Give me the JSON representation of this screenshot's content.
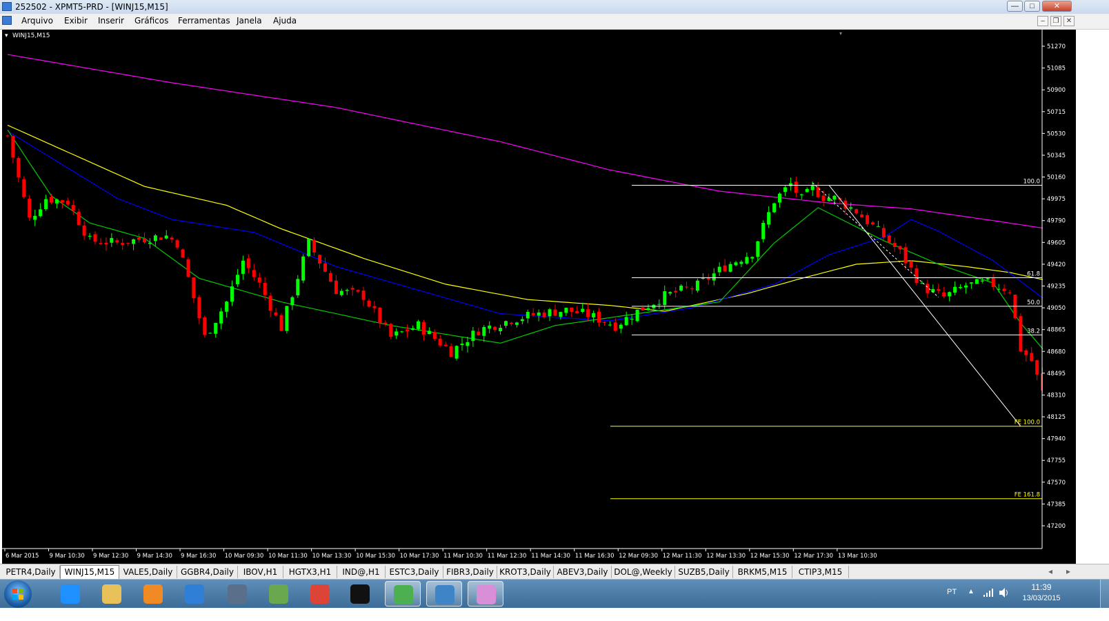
{
  "window": {
    "title": "252502 - XPMT5-PRD - [WINJ15,M15]",
    "minimize_glyph": "—",
    "maximize_glyph": "□",
    "close_glyph": "✕"
  },
  "menu": {
    "items": [
      "Arquivo",
      "Exibir",
      "Inserir",
      "Gráficos",
      "Ferramentas",
      "Janela",
      "Ajuda"
    ],
    "mdi_buttons": [
      "–",
      "❐",
      "✕"
    ]
  },
  "chart_data": {
    "type": "candlestick",
    "symbol_label": "WINJ15,M15",
    "y_ticks": [
      51270,
      51085,
      50900,
      50715,
      50530,
      50345,
      50160,
      49975,
      49790,
      49605,
      49420,
      49235,
      49050,
      48865,
      48680,
      48495,
      48310,
      48125,
      47940,
      47755,
      47570,
      47385,
      47200
    ],
    "ylim": [
      47000,
      51340
    ],
    "x_ticks": [
      "6 Mar 2015",
      "9 Mar 10:30",
      "9 Mar 12:30",
      "9 Mar 14:30",
      "9 Mar 16:30",
      "10 Mar 09:30",
      "10 Mar 11:30",
      "10 Mar 13:30",
      "10 Mar 15:30",
      "10 Mar 17:30",
      "11 Mar 10:30",
      "11 Mar 12:30",
      "11 Mar 14:30",
      "11 Mar 16:30",
      "12 Mar 09:30",
      "12 Mar 11:30",
      "12 Mar 13:30",
      "12 Mar 15:30",
      "12 Mar 17:30",
      "13 Mar 10:30"
    ],
    "x_tick_step": 8,
    "close_anchors": [
      [
        0,
        50510
      ],
      [
        2,
        50150
      ],
      [
        4,
        49800
      ],
      [
        7,
        49980
      ],
      [
        11,
        49950
      ],
      [
        15,
        49620
      ],
      [
        20,
        49600
      ],
      [
        25,
        49640
      ],
      [
        29,
        49660
      ],
      [
        31,
        49600
      ],
      [
        33,
        49300
      ],
      [
        36,
        48800
      ],
      [
        40,
        49100
      ],
      [
        43,
        49450
      ],
      [
        46,
        49250
      ],
      [
        50,
        48880
      ],
      [
        55,
        49600
      ],
      [
        60,
        49200
      ],
      [
        65,
        49150
      ],
      [
        70,
        48800
      ],
      [
        75,
        48900
      ],
      [
        81,
        48680
      ],
      [
        86,
        48860
      ],
      [
        92,
        48950
      ],
      [
        97,
        49000
      ],
      [
        102,
        49030
      ],
      [
        106,
        48990
      ],
      [
        111,
        48900
      ],
      [
        115,
        49020
      ],
      [
        120,
        49150
      ],
      [
        126,
        49240
      ],
      [
        131,
        49400
      ],
      [
        136,
        49520
      ],
      [
        140,
        49960
      ],
      [
        143,
        50100
      ],
      [
        145,
        49970
      ],
      [
        147,
        50060
      ],
      [
        149,
        49990
      ],
      [
        151,
        49980
      ],
      [
        155,
        49870
      ],
      [
        159,
        49700
      ],
      [
        163,
        49520
      ],
      [
        167,
        49230
      ],
      [
        171,
        49140
      ],
      [
        175,
        49240
      ],
      [
        179,
        49260
      ],
      [
        183,
        49200
      ],
      [
        185,
        48700
      ],
      [
        187,
        48600
      ],
      [
        189,
        48330
      ],
      [
        191,
        48470
      ],
      [
        193,
        48520
      ],
      [
        195,
        48560
      ],
      [
        197,
        48600
      ],
      [
        199,
        48680
      ]
    ],
    "series": [
      {
        "name": "",
        "color": "#ff00ff",
        "points": [
          [
            0,
            51200
          ],
          [
            30,
            50960
          ],
          [
            60,
            50750
          ],
          [
            90,
            50460
          ],
          [
            110,
            50220
          ],
          [
            130,
            50040
          ],
          [
            150,
            49940
          ],
          [
            165,
            49890
          ],
          [
            180,
            49790
          ],
          [
            190,
            49720
          ],
          [
            199,
            49660
          ]
        ]
      },
      {
        "name": "",
        "color": "#ffff00",
        "points": [
          [
            0,
            50600
          ],
          [
            25,
            50080
          ],
          [
            40,
            49920
          ],
          [
            50,
            49720
          ],
          [
            65,
            49470
          ],
          [
            80,
            49250
          ],
          [
            95,
            49120
          ],
          [
            110,
            49070
          ],
          [
            120,
            49020
          ],
          [
            135,
            49170
          ],
          [
            145,
            49300
          ],
          [
            155,
            49420
          ],
          [
            165,
            49450
          ],
          [
            175,
            49400
          ],
          [
            183,
            49350
          ],
          [
            190,
            49280
          ],
          [
            199,
            49090
          ]
        ]
      },
      {
        "name": "",
        "color": "#0000ff",
        "points": [
          [
            0,
            50550
          ],
          [
            20,
            49980
          ],
          [
            30,
            49800
          ],
          [
            45,
            49690
          ],
          [
            60,
            49400
          ],
          [
            75,
            49200
          ],
          [
            90,
            49000
          ],
          [
            110,
            48940
          ],
          [
            125,
            49050
          ],
          [
            140,
            49250
          ],
          [
            150,
            49500
          ],
          [
            160,
            49650
          ],
          [
            165,
            49800
          ],
          [
            170,
            49700
          ],
          [
            180,
            49450
          ],
          [
            190,
            49100
          ],
          [
            199,
            48880
          ]
        ]
      },
      {
        "name": "",
        "color": "#00cc00",
        "points": [
          [
            0,
            50560
          ],
          [
            8,
            50000
          ],
          [
            15,
            49770
          ],
          [
            25,
            49640
          ],
          [
            35,
            49300
          ],
          [
            50,
            49100
          ],
          [
            70,
            48900
          ],
          [
            90,
            48750
          ],
          [
            100,
            48900
          ],
          [
            115,
            49000
          ],
          [
            130,
            49100
          ],
          [
            140,
            49600
          ],
          [
            148,
            49900
          ],
          [
            160,
            49620
          ],
          [
            170,
            49420
          ],
          [
            180,
            49260
          ],
          [
            185,
            48920
          ],
          [
            190,
            48650
          ],
          [
            195,
            48560
          ],
          [
            199,
            48620
          ]
        ]
      }
    ],
    "fibonacci_retracement": {
      "levels": [
        {
          "label": "100.0",
          "price": 50090
        },
        {
          "label": "61.8",
          "price": 49305
        },
        {
          "label": "50.0",
          "price": 49063
        },
        {
          "label": "38.2",
          "price": 48820
        }
      ]
    },
    "fibonacci_expansion": {
      "levels": [
        {
          "label": "FE 100.0",
          "price": 48045
        },
        {
          "label": "FE 161.8",
          "price": 47430
        }
      ],
      "color": "#ffff00"
    },
    "trend_lines": [
      {
        "from": [
          150,
          50090
        ],
        "to": [
          185,
          48045
        ],
        "color": "#ffffff",
        "dash": false
      },
      {
        "from": [
          147,
          50110
        ],
        "to": [
          170,
          49140
        ],
        "color": "#ffffff",
        "dash": true
      }
    ],
    "grid": false,
    "bull_color": "#00ff00",
    "bear_color": "#ff0000"
  },
  "symbol_tabs": [
    "PETR4,Daily",
    "WINJ15,M15",
    "VALE5,Daily",
    "GGBR4,Daily",
    "IBOV,H1",
    "HGTX3,H1",
    "IND@,H1",
    "ESTC3,Daily",
    "FIBR3,Daily",
    "KROT3,Daily",
    "ABEV3,Daily",
    "DOL@,Weekly",
    "SUZB5,Daily",
    "BRKM5,M15",
    "CTIP3,M15"
  ],
  "active_tab": "WINJ15,M15",
  "tab_scroll": {
    "left": "◂",
    "right": "▸"
  },
  "taskbar": {
    "apps": [
      {
        "name": "internet-explorer-icon",
        "color": "#1e90ff"
      },
      {
        "name": "file-explorer-icon",
        "color": "#e8c15a"
      },
      {
        "name": "media-player-icon",
        "color": "#f08a24"
      },
      {
        "name": "remote-desktop-icon",
        "color": "#2f7fd6"
      },
      {
        "name": "hp-icon",
        "color": "#5a6f8a"
      },
      {
        "name": "briefcase-icon",
        "color": "#6aa84f"
      },
      {
        "name": "chrome-icon",
        "color": "#db4437"
      },
      {
        "name": "xp-icon",
        "color": "#111111"
      },
      {
        "name": "metatrader-icon",
        "color": "#4caf50",
        "active": true
      },
      {
        "name": "picture-viewer-icon",
        "color": "#3d85c6",
        "active": true
      },
      {
        "name": "paint-icon",
        "color": "#d88fd8",
        "active": true
      }
    ],
    "language": "PT",
    "time": "11:39",
    "date": "13/03/2015"
  }
}
